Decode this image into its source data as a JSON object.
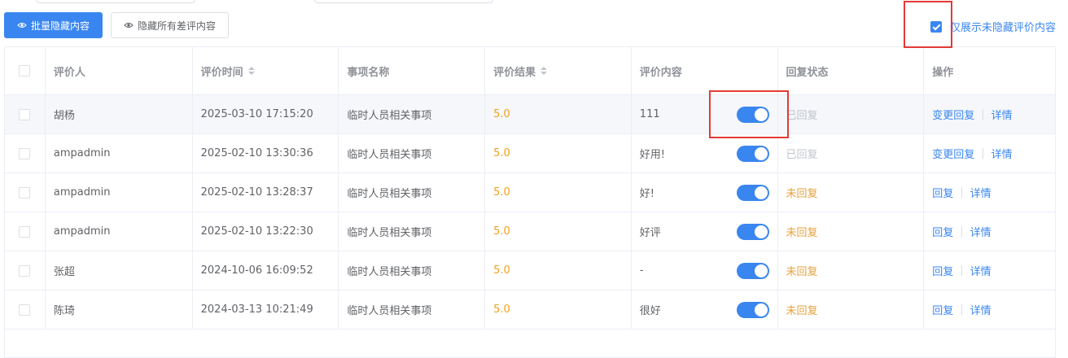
{
  "toolbar": {
    "batch_hide_label": "批量隐藏内容",
    "hide_all_negative_label": "隐藏所有差评内容"
  },
  "filter": {
    "only_unhidden_label": "仅展示未隐藏评价内容",
    "checked": true
  },
  "table": {
    "headers": {
      "reviewer": "评价人",
      "time": "评价时间",
      "item": "事项名称",
      "result": "评价结果",
      "content": "评价内容",
      "reply_status": "回复状态",
      "actions": "操作"
    },
    "rows": [
      {
        "reviewer": "胡杨",
        "time": "2025-03-10 17:15:20",
        "item": "临时人员相关事项",
        "result": "5.0",
        "content": "111",
        "status": "已回复",
        "action1": "变更回复",
        "action2": "详情"
      },
      {
        "reviewer": "ampadmin",
        "time": "2025-02-10 13:30:36",
        "item": "临时人员相关事项",
        "result": "5.0",
        "content": "好用!",
        "status": "已回复",
        "action1": "变更回复",
        "action2": "详情"
      },
      {
        "reviewer": "ampadmin",
        "time": "2025-02-10 13:28:37",
        "item": "临时人员相关事项",
        "result": "5.0",
        "content": "好!",
        "status": "未回复",
        "action1": "回复",
        "action2": "详情"
      },
      {
        "reviewer": "ampadmin",
        "time": "2025-02-10 13:22:30",
        "item": "临时人员相关事项",
        "result": "5.0",
        "content": "好评",
        "status": "未回复",
        "action1": "回复",
        "action2": "详情"
      },
      {
        "reviewer": "张超",
        "time": "2024-10-06 16:09:52",
        "item": "临时人员相关事项",
        "result": "5.0",
        "content": "-",
        "status": "未回复",
        "action1": "回复",
        "action2": "详情"
      },
      {
        "reviewer": "陈琦",
        "time": "2024-03-13 10:21:49",
        "item": "临时人员相关事项",
        "result": "5.0",
        "content": "很好",
        "status": "未回复",
        "action1": "回复",
        "action2": "详情"
      }
    ]
  },
  "colors": {
    "primary": "#3a86f0",
    "score": "#f0a020",
    "pending": "#e6a23c",
    "replied": "#c0c4cc",
    "highlight": "#e53935"
  }
}
